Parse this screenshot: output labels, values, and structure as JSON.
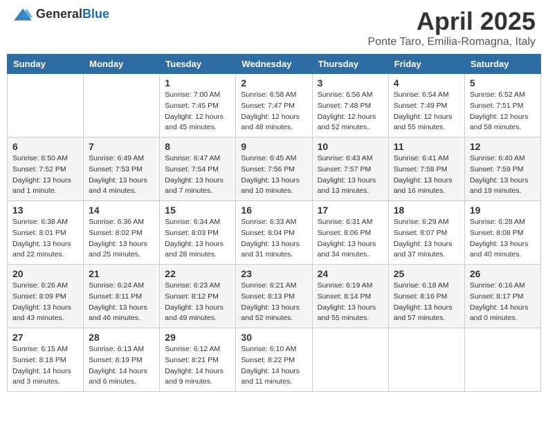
{
  "header": {
    "logo_general": "General",
    "logo_blue": "Blue",
    "title": "April 2025",
    "subtitle": "Ponte Taro, Emilia-Romagna, Italy"
  },
  "weekdays": [
    "Sunday",
    "Monday",
    "Tuesday",
    "Wednesday",
    "Thursday",
    "Friday",
    "Saturday"
  ],
  "weeks": [
    [
      {
        "day": "",
        "sunrise": "",
        "sunset": "",
        "daylight": ""
      },
      {
        "day": "",
        "sunrise": "",
        "sunset": "",
        "daylight": ""
      },
      {
        "day": "1",
        "sunrise": "Sunrise: 7:00 AM",
        "sunset": "Sunset: 7:45 PM",
        "daylight": "Daylight: 12 hours and 45 minutes."
      },
      {
        "day": "2",
        "sunrise": "Sunrise: 6:58 AM",
        "sunset": "Sunset: 7:47 PM",
        "daylight": "Daylight: 12 hours and 48 minutes."
      },
      {
        "day": "3",
        "sunrise": "Sunrise: 6:56 AM",
        "sunset": "Sunset: 7:48 PM",
        "daylight": "Daylight: 12 hours and 52 minutes."
      },
      {
        "day": "4",
        "sunrise": "Sunrise: 6:54 AM",
        "sunset": "Sunset: 7:49 PM",
        "daylight": "Daylight: 12 hours and 55 minutes."
      },
      {
        "day": "5",
        "sunrise": "Sunrise: 6:52 AM",
        "sunset": "Sunset: 7:51 PM",
        "daylight": "Daylight: 12 hours and 58 minutes."
      }
    ],
    [
      {
        "day": "6",
        "sunrise": "Sunrise: 6:50 AM",
        "sunset": "Sunset: 7:52 PM",
        "daylight": "Daylight: 13 hours and 1 minute."
      },
      {
        "day": "7",
        "sunrise": "Sunrise: 6:49 AM",
        "sunset": "Sunset: 7:53 PM",
        "daylight": "Daylight: 13 hours and 4 minutes."
      },
      {
        "day": "8",
        "sunrise": "Sunrise: 6:47 AM",
        "sunset": "Sunset: 7:54 PM",
        "daylight": "Daylight: 13 hours and 7 minutes."
      },
      {
        "day": "9",
        "sunrise": "Sunrise: 6:45 AM",
        "sunset": "Sunset: 7:56 PM",
        "daylight": "Daylight: 13 hours and 10 minutes."
      },
      {
        "day": "10",
        "sunrise": "Sunrise: 6:43 AM",
        "sunset": "Sunset: 7:57 PM",
        "daylight": "Daylight: 13 hours and 13 minutes."
      },
      {
        "day": "11",
        "sunrise": "Sunrise: 6:41 AM",
        "sunset": "Sunset: 7:58 PM",
        "daylight": "Daylight: 13 hours and 16 minutes."
      },
      {
        "day": "12",
        "sunrise": "Sunrise: 6:40 AM",
        "sunset": "Sunset: 7:59 PM",
        "daylight": "Daylight: 13 hours and 19 minutes."
      }
    ],
    [
      {
        "day": "13",
        "sunrise": "Sunrise: 6:38 AM",
        "sunset": "Sunset: 8:01 PM",
        "daylight": "Daylight: 13 hours and 22 minutes."
      },
      {
        "day": "14",
        "sunrise": "Sunrise: 6:36 AM",
        "sunset": "Sunset: 8:02 PM",
        "daylight": "Daylight: 13 hours and 25 minutes."
      },
      {
        "day": "15",
        "sunrise": "Sunrise: 6:34 AM",
        "sunset": "Sunset: 8:03 PM",
        "daylight": "Daylight: 13 hours and 28 minutes."
      },
      {
        "day": "16",
        "sunrise": "Sunrise: 6:33 AM",
        "sunset": "Sunset: 8:04 PM",
        "daylight": "Daylight: 13 hours and 31 minutes."
      },
      {
        "day": "17",
        "sunrise": "Sunrise: 6:31 AM",
        "sunset": "Sunset: 8:06 PM",
        "daylight": "Daylight: 13 hours and 34 minutes."
      },
      {
        "day": "18",
        "sunrise": "Sunrise: 6:29 AM",
        "sunset": "Sunset: 8:07 PM",
        "daylight": "Daylight: 13 hours and 37 minutes."
      },
      {
        "day": "19",
        "sunrise": "Sunrise: 6:28 AM",
        "sunset": "Sunset: 8:08 PM",
        "daylight": "Daylight: 13 hours and 40 minutes."
      }
    ],
    [
      {
        "day": "20",
        "sunrise": "Sunrise: 6:26 AM",
        "sunset": "Sunset: 8:09 PM",
        "daylight": "Daylight: 13 hours and 43 minutes."
      },
      {
        "day": "21",
        "sunrise": "Sunrise: 6:24 AM",
        "sunset": "Sunset: 8:11 PM",
        "daylight": "Daylight: 13 hours and 46 minutes."
      },
      {
        "day": "22",
        "sunrise": "Sunrise: 6:23 AM",
        "sunset": "Sunset: 8:12 PM",
        "daylight": "Daylight: 13 hours and 49 minutes."
      },
      {
        "day": "23",
        "sunrise": "Sunrise: 6:21 AM",
        "sunset": "Sunset: 8:13 PM",
        "daylight": "Daylight: 13 hours and 52 minutes."
      },
      {
        "day": "24",
        "sunrise": "Sunrise: 6:19 AM",
        "sunset": "Sunset: 8:14 PM",
        "daylight": "Daylight: 13 hours and 55 minutes."
      },
      {
        "day": "25",
        "sunrise": "Sunrise: 6:18 AM",
        "sunset": "Sunset: 8:16 PM",
        "daylight": "Daylight: 13 hours and 57 minutes."
      },
      {
        "day": "26",
        "sunrise": "Sunrise: 6:16 AM",
        "sunset": "Sunset: 8:17 PM",
        "daylight": "Daylight: 14 hours and 0 minutes."
      }
    ],
    [
      {
        "day": "27",
        "sunrise": "Sunrise: 6:15 AM",
        "sunset": "Sunset: 8:18 PM",
        "daylight": "Daylight: 14 hours and 3 minutes."
      },
      {
        "day": "28",
        "sunrise": "Sunrise: 6:13 AM",
        "sunset": "Sunset: 8:19 PM",
        "daylight": "Daylight: 14 hours and 6 minutes."
      },
      {
        "day": "29",
        "sunrise": "Sunrise: 6:12 AM",
        "sunset": "Sunset: 8:21 PM",
        "daylight": "Daylight: 14 hours and 9 minutes."
      },
      {
        "day": "30",
        "sunrise": "Sunrise: 6:10 AM",
        "sunset": "Sunset: 8:22 PM",
        "daylight": "Daylight: 14 hours and 11 minutes."
      },
      {
        "day": "",
        "sunrise": "",
        "sunset": "",
        "daylight": ""
      },
      {
        "day": "",
        "sunrise": "",
        "sunset": "",
        "daylight": ""
      },
      {
        "day": "",
        "sunrise": "",
        "sunset": "",
        "daylight": ""
      }
    ]
  ]
}
